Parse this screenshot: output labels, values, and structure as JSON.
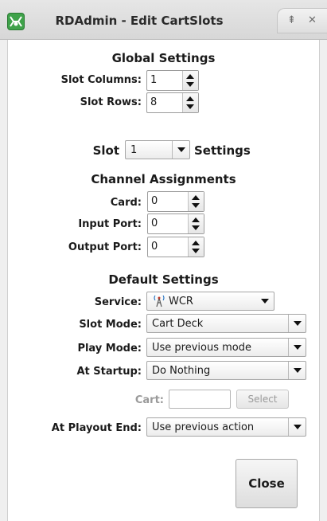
{
  "window": {
    "title": "RDAdmin - Edit CartSlots",
    "controls": {
      "restore_glyph": "⇞",
      "close_glyph": "✕"
    }
  },
  "global_settings": {
    "heading": "Global Settings",
    "slot_columns_label": "Slot Columns:",
    "slot_columns_value": "1",
    "slot_rows_label": "Slot Rows:",
    "slot_rows_value": "8"
  },
  "slot_selector": {
    "prefix": "Slot",
    "value": "1",
    "suffix": "Settings"
  },
  "channel_assignments": {
    "heading": "Channel Assignments",
    "card_label": "Card:",
    "card_value": "0",
    "input_port_label": "Input Port:",
    "input_port_value": "0",
    "output_port_label": "Output Port:",
    "output_port_value": "0"
  },
  "default_settings": {
    "heading": "Default Settings",
    "service_label": "Service:",
    "service_value": "WCR",
    "service_icon": "tower-icon",
    "slot_mode_label": "Slot Mode:",
    "slot_mode_value": "Cart Deck",
    "play_mode_label": "Play Mode:",
    "play_mode_value": "Use previous mode",
    "at_startup_label": "At Startup:",
    "at_startup_value": "Do Nothing",
    "cart_label": "Cart:",
    "cart_value": "",
    "select_button": "Select",
    "at_playout_end_label": "At Playout End:",
    "at_playout_end_value": "Use previous action"
  },
  "close_button": "Close",
  "colors": {
    "accent_icon": "#3fa24a",
    "disabled_text": "#9a9a9a"
  }
}
